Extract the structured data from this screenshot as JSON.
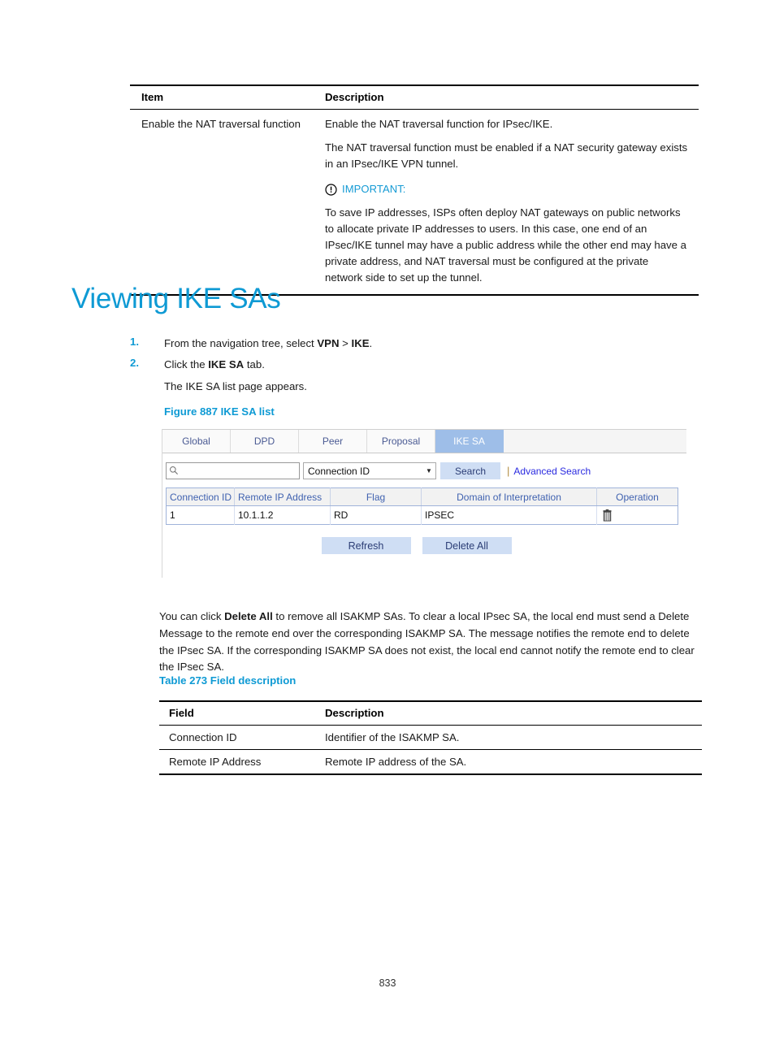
{
  "top_table": {
    "headers": [
      "Item",
      "Description"
    ],
    "rows": [
      {
        "item": "Enable the NAT traversal function",
        "paragraphs": [
          "Enable the NAT traversal function for IPsec/IKE.",
          "The NAT traversal function must be enabled if a NAT security gateway exists in an IPsec/IKE VPN tunnel."
        ],
        "note": {
          "icon": "important-icon",
          "label": "IMPORTANT:",
          "text": "To save IP addresses, ISPs often deploy NAT gateways on public networks to allocate private IP addresses to users. In this case, one end of an IPsec/IKE tunnel may have a public address while the other end may have a private address, and NAT traversal must be configured at the private network side to set up the tunnel."
        }
      }
    ]
  },
  "heading": "Viewing IKE SAs",
  "steps": [
    {
      "number": "1.",
      "text_before": "From the navigation tree, select ",
      "bold1": "VPN",
      "text_mid": " > ",
      "bold2": "IKE",
      "text_after": "."
    },
    {
      "number": "2.",
      "text_before": "Click the ",
      "bold1": "IKE SA",
      "text_mid": "",
      "bold2": "",
      "text_after": " tab."
    }
  ],
  "step_sub_line": "The IKE SA list page appears.",
  "figure_caption": "Figure 887 IKE SA list",
  "app": {
    "tabs": [
      {
        "label": "Global",
        "active": false
      },
      {
        "label": "DPD",
        "active": false
      },
      {
        "label": "Peer",
        "active": false
      },
      {
        "label": "Proposal",
        "active": false
      },
      {
        "label": "IKE SA",
        "active": true
      }
    ],
    "search": {
      "input_value": "",
      "input_placeholder": "",
      "icon": "search-icon",
      "select_value": "Connection ID",
      "select_options": [
        "Connection ID",
        "Remote IP Address",
        "Flag",
        "Domain of Interpretation"
      ],
      "search_button": "Search",
      "separator": "|",
      "advanced_search": "Advanced Search"
    },
    "grid": {
      "columns": [
        "Connection ID",
        "Remote IP Address",
        "Flag",
        "Domain of Interpretation",
        "Operation"
      ],
      "rows": [
        {
          "connection_id": "1",
          "remote_ip": "10.1.1.2",
          "flag": "RD",
          "doi": "IPSEC",
          "operation_icon": "trash-icon"
        }
      ]
    },
    "buttons": {
      "refresh": "Refresh",
      "delete_all": "Delete All"
    },
    "colors": {
      "active_tab_bg": "#9EBEE8",
      "button_bg": "#CFDEF4",
      "header_text": "#4062B0",
      "link": "#2a2ae0"
    }
  },
  "post_paragraph": {
    "part1": "You can click ",
    "bold": "Delete All",
    "part2": " to remove all ISAKMP SAs. To clear a local IPsec SA, the local end must send a Delete Message to the remote end over the corresponding ISAKMP SA. The message notifies the remote end to delete the IPsec SA. If the corresponding ISAKMP SA does not exist, the local end cannot notify the remote end to clear the IPsec SA."
  },
  "table_caption": "Table 273 Field description",
  "field_table": {
    "headers": [
      "Field",
      "Description"
    ],
    "rows": [
      {
        "field": "Connection ID",
        "description": "Identifier of the ISAKMP SA."
      },
      {
        "field": "Remote IP Address",
        "description": "Remote IP address of the SA."
      }
    ]
  },
  "page_number": "833",
  "theme": {
    "accent_blue": "#0E9AD4"
  }
}
